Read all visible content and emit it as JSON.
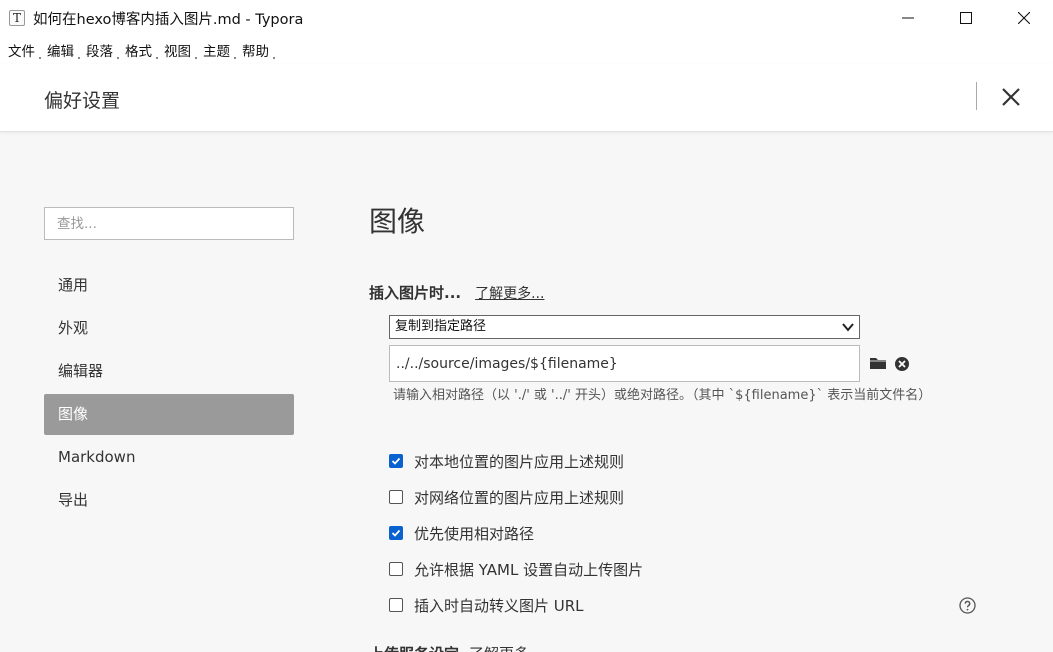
{
  "window": {
    "title": "如何在hexo博客内插入图片.md - Typora",
    "app_icon_glyph": "T",
    "controls": [
      "minimize-icon",
      "maximize-icon",
      "close-icon"
    ]
  },
  "menu": [
    "文件",
    "编辑",
    "段落",
    "格式",
    "视图",
    "主题",
    "帮助"
  ],
  "preferences": {
    "title": "偏好设置",
    "search_placeholder": "查找...",
    "nav": [
      {
        "label": "通用",
        "active": false
      },
      {
        "label": "外观",
        "active": false
      },
      {
        "label": "编辑器",
        "active": false
      },
      {
        "label": "图像",
        "active": true
      },
      {
        "label": "Markdown",
        "active": false
      },
      {
        "label": "导出",
        "active": false
      }
    ]
  },
  "image_section": {
    "title": "图像",
    "insert_label": "插入图片时...",
    "learn_more": "了解更多...",
    "action_select": "复制到指定路径",
    "path_value": "../../source/images/${filename}",
    "path_help": "请输入相对路径（以 './' 或 '../' 开头）或绝对路径。（其中 `${filename}` 表示当前文件名）",
    "options": [
      {
        "label": "对本地位置的图片应用上述规则",
        "checked": true
      },
      {
        "label": "对网络位置的图片应用上述规则",
        "checked": false
      },
      {
        "label": "优先使用相对路径",
        "checked": true
      },
      {
        "label": "允许根据 YAML 设置自动上传图片",
        "checked": false
      },
      {
        "label": "插入时自动转义图片 URL",
        "checked": false
      }
    ],
    "next_heading": "上传服务设定",
    "next_heading_sub": "了解更多"
  },
  "colors": {
    "accent": "#0a62d0",
    "active_nav": "#9a9a9a"
  }
}
